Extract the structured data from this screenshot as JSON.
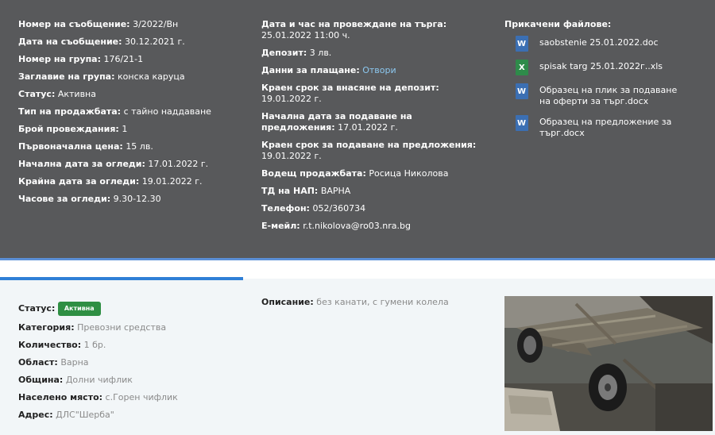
{
  "left_info": [
    {
      "label": "Номер на съобщение:",
      "value": "3/2022/Вн"
    },
    {
      "label": "Дата на съобщение:",
      "value": "30.12.2021 г."
    },
    {
      "label": "Номер на група:",
      "value": "176/21-1"
    },
    {
      "label": "Заглавие на група:",
      "value": "конска каруца"
    },
    {
      "label": "Статус:",
      "value": "Активна"
    },
    {
      "label": "Тип на продажбата:",
      "value": "с тайно наддаване"
    },
    {
      "label": "Брой провеждания:",
      "value": "1"
    },
    {
      "label": "Първоначална цена:",
      "value": "15 лв."
    },
    {
      "label": "Начална дата за огледи:",
      "value": "17.01.2022 г."
    },
    {
      "label": "Крайна дата за огледи:",
      "value": "19.01.2022 г."
    },
    {
      "label": "Часове за огледи:",
      "value": "9.30-12.30"
    }
  ],
  "middle_info": {
    "auction_datetime": {
      "label": "Дата и час на провеждане на търга:",
      "value": "25.01.2022 11:00 ч."
    },
    "deposit": {
      "label": "Депозит:",
      "value": "3 лв."
    },
    "payment": {
      "label": "Данни за плащане:",
      "link": "Отвори"
    },
    "deposit_deadline": {
      "label": "Краен срок за внасяне на депозит:",
      "value": "19.01.2022 г."
    },
    "offers_start": {
      "label": "Начална дата за подаване на предложения:",
      "value": "17.01.2022 г."
    },
    "offers_deadline": {
      "label": "Краен срок за подаване на предложения:",
      "value": "19.01.2022 г."
    },
    "lead": {
      "label": "Водещ продажбата:",
      "value": "Росица Николова"
    },
    "td": {
      "label": "ТД на НАП:",
      "value": "ВАРНА"
    },
    "phone": {
      "label": "Телефон:",
      "value": "052/360734"
    },
    "email": {
      "label": "E-мейл:",
      "value": "r.t.nikolova@ro03.nra.bg"
    }
  },
  "files": {
    "title": "Прикачени файлове:",
    "items": [
      {
        "name": "saobstenie 25.01.2022.doc",
        "icon": "word-doc-icon"
      },
      {
        "name": "spisak targ 25.01.2022г..xls",
        "icon": "excel-xls-icon"
      },
      {
        "name": "Образец на плик за подаване на оферти за търг.docx",
        "icon": "word-doc-icon"
      },
      {
        "name": "Образец на предложение за търг.docx",
        "icon": "word-doc-icon"
      }
    ]
  },
  "item": {
    "status_label": "Статус:",
    "status_badge": "Активна",
    "details": [
      {
        "label": "Категория:",
        "value": "Превозни средства"
      },
      {
        "label": "Количество:",
        "value": "1 бр."
      },
      {
        "label": "Област:",
        "value": "Варна"
      },
      {
        "label": "Община:",
        "value": "Долни чифлик"
      },
      {
        "label": "Населено място:",
        "value": "с.Горен чифлик"
      },
      {
        "label": "Адрес:",
        "value": "ДЛС\"Шерба\""
      }
    ],
    "description_label": "Описание:",
    "description": "без канати, с гумени колела"
  },
  "colors": {
    "panel": "#58595b",
    "accent": "#2f7fd6",
    "badge": "#2f8f43",
    "link": "#8cc8f0"
  }
}
